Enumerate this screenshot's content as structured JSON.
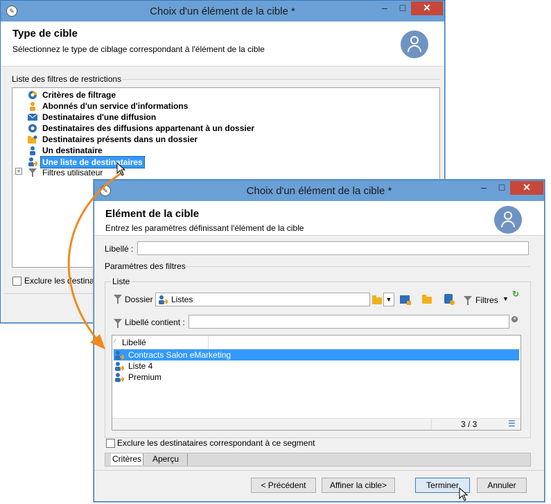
{
  "window1": {
    "title": "Choix d'un élément de la cible *",
    "header_title": "Type de cible",
    "header_subtitle": "Sélectionnez le type de ciblage correspondant à l'élément de la cible",
    "group_label": "Liste des filtres de restrictions",
    "tree_items": [
      {
        "label": "Critères de filtrage",
        "icon": "filter-criteria-icon"
      },
      {
        "label": "Abonnés d'un service d'informations",
        "icon": "subscriber-icon"
      },
      {
        "label": "Destinataires d'une diffusion",
        "icon": "delivery-envelope-icon"
      },
      {
        "label": "Destinataires des diffusions appartenant à un dossier",
        "icon": "delivery-folder-icon"
      },
      {
        "label": "Destinataires présents dans un dossier",
        "icon": "recipient-folder-icon"
      },
      {
        "label": "Un destinataire",
        "icon": "single-recipient-icon"
      },
      {
        "label": "Une liste de destinataires",
        "icon": "recipient-list-icon",
        "selected": true
      },
      {
        "label": "Filtres utilisateur",
        "icon": "funnel-icon",
        "expandable": true,
        "expand_symbol": "+"
      }
    ],
    "exclude_label": "Exclure les destinata"
  },
  "window2": {
    "title": "Choix d'un élément de la cible *",
    "header_title": "Elément de la cible",
    "header_subtitle": "Entrez les paramètres définissant l'élément de la cible",
    "libelle_label": "Libellé :",
    "libelle_value": "",
    "params_label": "Paramètres des filtres",
    "liste_label": "Liste",
    "dossier_label": "Dossier :",
    "dossier_value": "Listes",
    "filtres_label": "Filtres",
    "libelle_contient_label": "Libellé contient :",
    "libelle_contient_value": "",
    "column_header": "Libellé",
    "rows": [
      {
        "label": "Contracts Salon eMarketing",
        "selected": true
      },
      {
        "label": "Liste 4",
        "selected": false
      },
      {
        "label": "Premium",
        "selected": false
      }
    ],
    "count": "3 / 3",
    "exclude_label": "Exclure les destinataires correspondant à ce segment",
    "tabs": [
      "Critères",
      "Aperçu"
    ],
    "buttons": {
      "previous": "< Précédent",
      "refine": "Affiner la cible>",
      "finish": "Terminer",
      "cancel": "Annuler"
    }
  },
  "colors": {
    "titlebar": "#6aa0d6",
    "selection": "#3399ff",
    "close": "#c7473a",
    "arrow": "#f08a1e"
  }
}
